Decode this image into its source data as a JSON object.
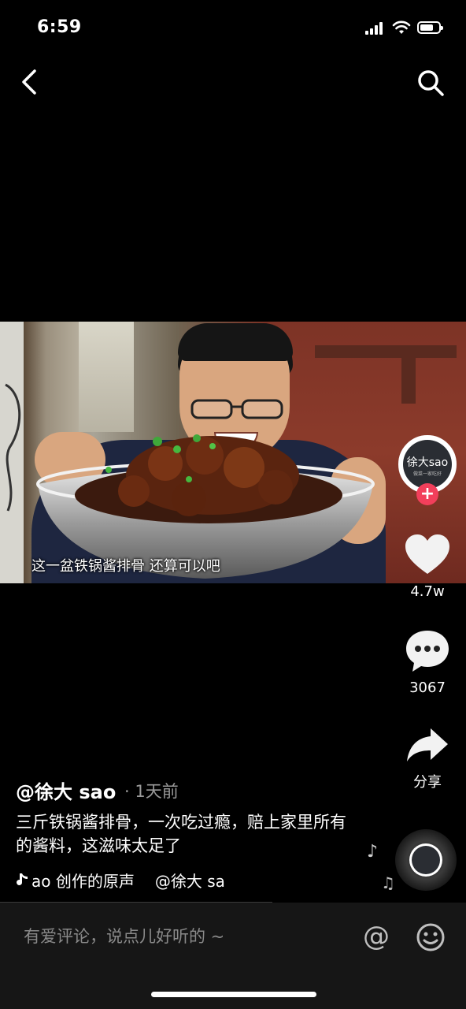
{
  "status_bar": {
    "time": "6:59"
  },
  "video": {
    "subtitle": "这一盆铁锅酱排骨 还算可以吧"
  },
  "creator": {
    "avatar_text": "徐大sao",
    "avatar_subtext": "做菜一家吃好"
  },
  "actions": {
    "like_count": "4.7w",
    "comment_count": "3067",
    "share_label": "分享"
  },
  "post": {
    "author": "@徐大 sao",
    "time_ago": "· 1天前",
    "description": "三斤铁锅酱排骨，一次吃过瘾，赔上家里所有的酱料，这滋味太足了",
    "music_text_1": "ao 创作的原声",
    "music_text_2": "@徐大 sa"
  },
  "comment_bar": {
    "placeholder": "有爱评论，说点儿好听的 ~",
    "at_symbol": "@"
  },
  "colors": {
    "background": "#000000",
    "follow_accent": "#f23f5b",
    "muted_text": "#9a9a9a"
  },
  "icons": [
    "back-icon",
    "search-icon",
    "heart-icon",
    "comment-icon",
    "share-icon",
    "plus-icon",
    "music-note-icon",
    "emoji-icon",
    "signal-icon",
    "wifi-icon",
    "battery-icon"
  ]
}
